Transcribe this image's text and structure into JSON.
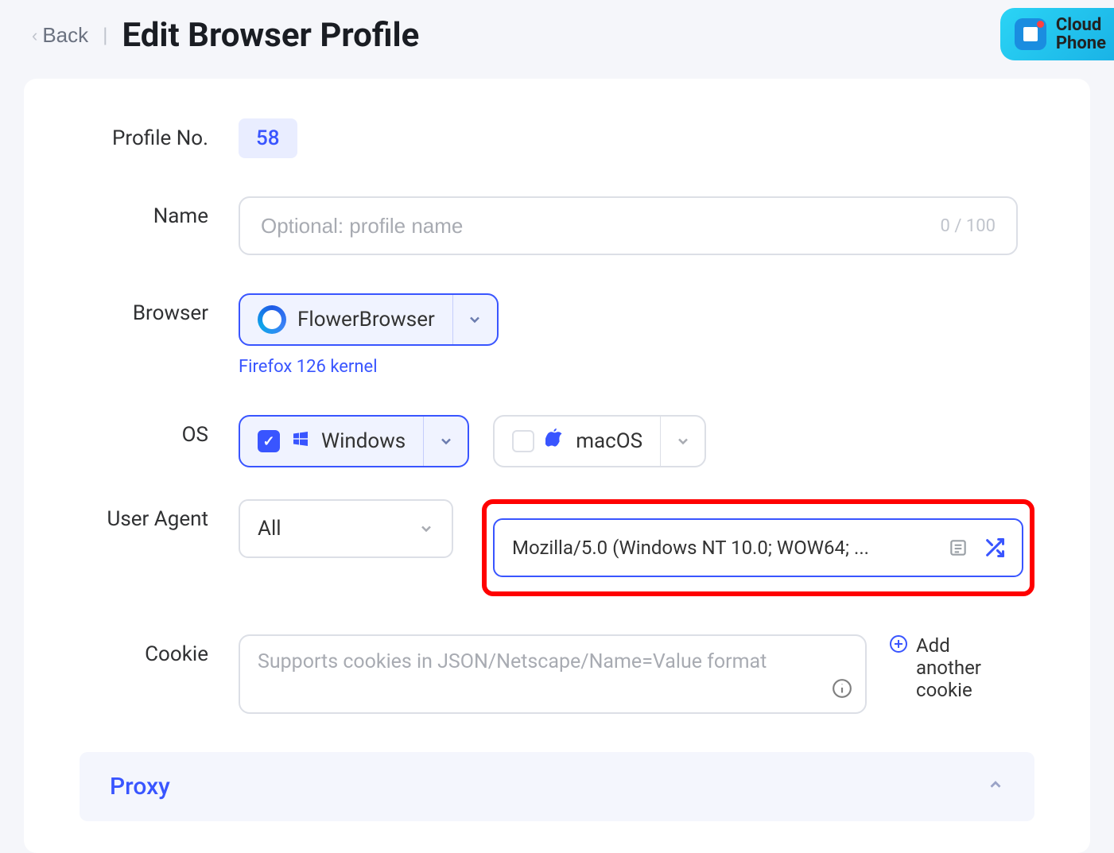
{
  "header": {
    "back_label": "Back",
    "title": "Edit Browser Profile",
    "cloud_line1": "Cloud",
    "cloud_line2": "Phone"
  },
  "profile": {
    "no_label": "Profile No.",
    "no_value": "58",
    "name_label": "Name",
    "name_placeholder": "Optional: profile name",
    "name_counter": "0 / 100",
    "browser_label": "Browser",
    "browser_selected": "FlowerBrowser",
    "kernel_note": "Firefox 126 kernel",
    "os_label": "OS",
    "os_windows": "Windows",
    "os_macos": "macOS",
    "ua_label": "User Agent",
    "ua_select_value": "All",
    "ua_value": "Mozilla/5.0 (Windows NT 10.0; WOW64; ...",
    "cookie_label": "Cookie",
    "cookie_placeholder": "Supports cookies in JSON/Netscape/Name=Value format",
    "add_cookie_label": "Add another cookie",
    "proxy_title": "Proxy"
  }
}
